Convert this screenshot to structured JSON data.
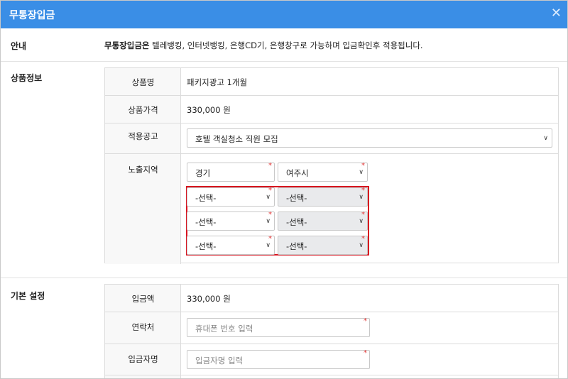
{
  "header": {
    "title": "무통장입금",
    "close_icon": "close-icon"
  },
  "notice": {
    "label": "안내",
    "text_bold": "무통장입금은",
    "text_rest": " 텔레뱅킹, 인터넷뱅킹, 은행CD기, 은행창구로 가능하며 입금확인후 적용됩니다."
  },
  "product": {
    "section_label": "상품정보",
    "name_label": "상품명",
    "name_value": "패키지광고 1개월",
    "price_label": "상품가격",
    "price_value": "330,000 원",
    "ad_label": "적용공고",
    "ad_value": "호텔 객실청소 직원 모집",
    "region_label": "노출지역",
    "regions": [
      {
        "province": "경기",
        "city": "여주시"
      },
      {
        "province": "-선택-",
        "city": "-선택-"
      },
      {
        "province": "-선택-",
        "city": "-선택-"
      },
      {
        "province": "-선택-",
        "city": "-선택-"
      }
    ]
  },
  "basic": {
    "section_label": "기본 설정",
    "amount_label": "입금액",
    "amount_value": "330,000 원",
    "contact_label": "연락처",
    "contact_placeholder": "휴대폰 번호 입력",
    "depositor_label": "입금자명",
    "depositor_placeholder": "입금자명 입력"
  },
  "colors": {
    "header_bg": "#3a8ee6",
    "highlight": "#d8131f",
    "required_star": "#e23333"
  }
}
